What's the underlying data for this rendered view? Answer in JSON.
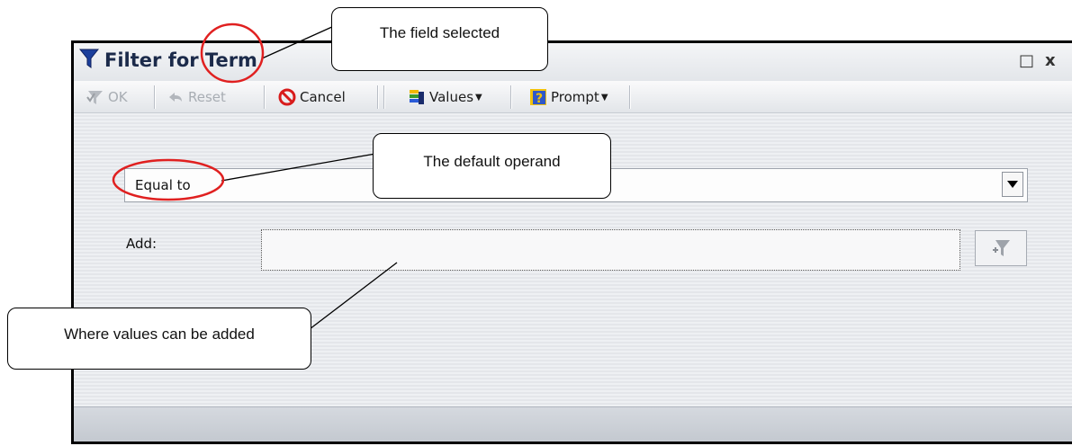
{
  "window": {
    "title": "Filter for Term",
    "maximize_glyph": "□",
    "close_glyph": "x"
  },
  "toolbar": {
    "ok_label": "OK",
    "reset_label": "Reset",
    "cancel_label": "Cancel",
    "values_label": "Values",
    "prompt_label": "Prompt"
  },
  "filter": {
    "operand_value": "Equal to",
    "add_label": "Add:",
    "add_value": ""
  },
  "callouts": {
    "field_selected": "The field selected",
    "default_operand": "The default operand",
    "values_added": "Where values can be added"
  },
  "colors": {
    "annotation_circle": "#e02020",
    "title_text": "#1b2a4a",
    "cancel_icon": "#d81c1c"
  }
}
